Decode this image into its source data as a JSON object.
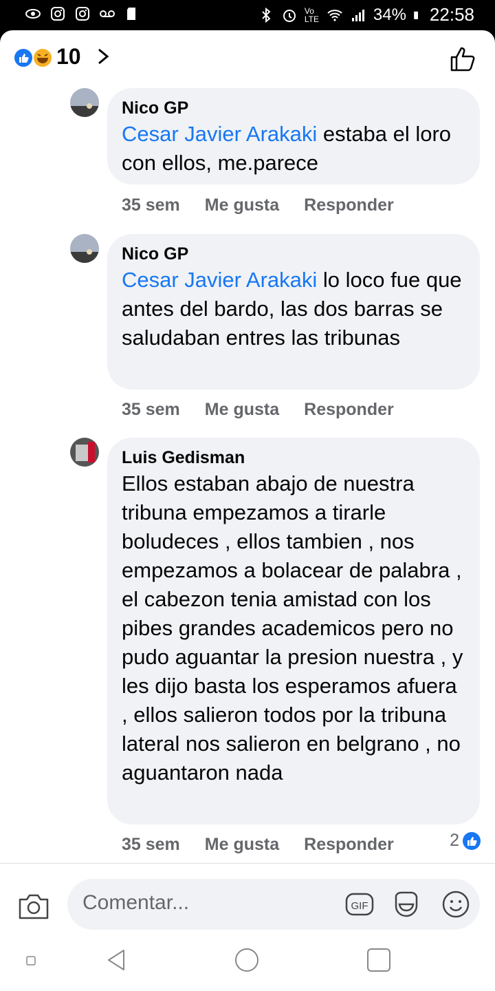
{
  "status_bar": {
    "battery": "34%",
    "time": "22:58",
    "network": "Vo LTE"
  },
  "reactions": {
    "count": "10"
  },
  "comments": [
    {
      "author": "Nico GP",
      "mention": "Cesar Javier Arakaki",
      "text": " estaba el loro con ellos, me.parece",
      "time": "35 sem",
      "like": "Me gusta",
      "reply": "Responder"
    },
    {
      "author": "Nico GP",
      "mention": "Cesar Javier Arakaki",
      "text": " lo loco fue que antes del bardo, las dos barras se saludaban entres las tribunas",
      "time": "35 sem",
      "like": "Me gusta",
      "reply": "Responder"
    },
    {
      "author": "Luis Gedisman",
      "text": "Ellos estaban abajo de nuestra tribuna empezamos a tirarle boludeces , ellos tambien , nos empezamos a bolacear de palabra , el cabezon tenia amistad con los pibes grandes academicos pero no pudo aguantar la presion nuestra , y les dijo basta los esperamos afuera  , ellos salieron todos por la tribuna lateral nos salieron en belgrano , no aguantaron nada",
      "time": "35 sem",
      "like": "Me gusta",
      "reply": "Responder",
      "reaction_count": "2"
    }
  ],
  "composer": {
    "placeholder": "Comentar...",
    "gif_label": "GIF"
  },
  "colors": {
    "accent": "#1877f2",
    "bubble": "#f0f2f5",
    "secondary_text": "#65676b"
  }
}
